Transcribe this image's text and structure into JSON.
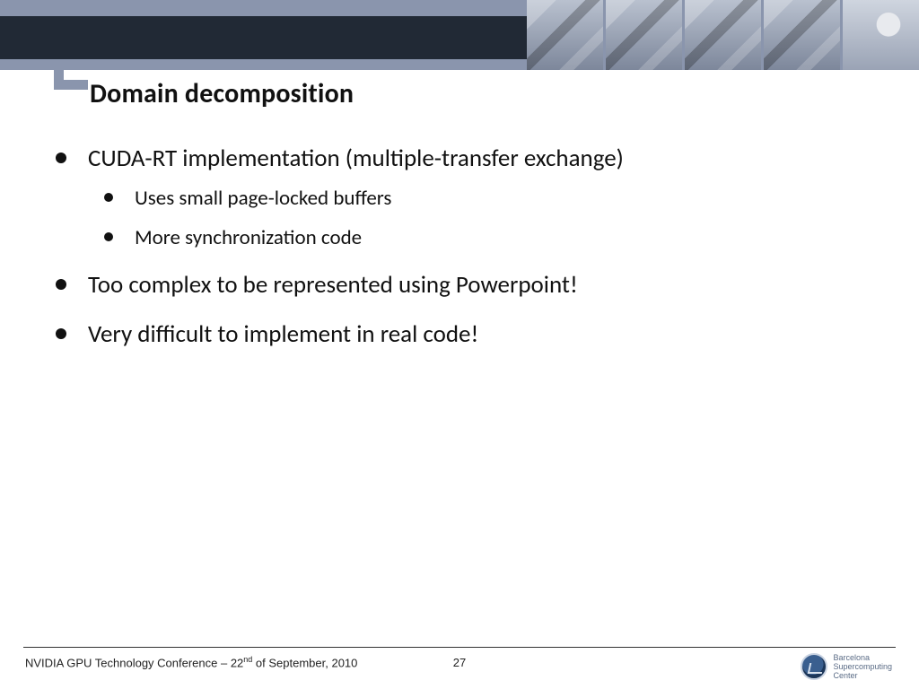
{
  "title": "Domain decomposition",
  "bullets": {
    "b1": "CUDA-RT implementation (multiple-transfer exchange)",
    "b1_1": "Uses small page-locked buffers",
    "b1_2": "More synchronization code",
    "b2": "Too complex to be represented using Powerpoint!",
    "b3": "Very difficult to implement in real code!"
  },
  "footer": {
    "left_pre": "NVIDIA GPU Technology Conference – 22",
    "left_sup": "nd",
    "left_post": " of September, 2010",
    "page": "27",
    "logo_line1": "Barcelona",
    "logo_line2": "Supercomputing",
    "logo_line3": "Center"
  }
}
